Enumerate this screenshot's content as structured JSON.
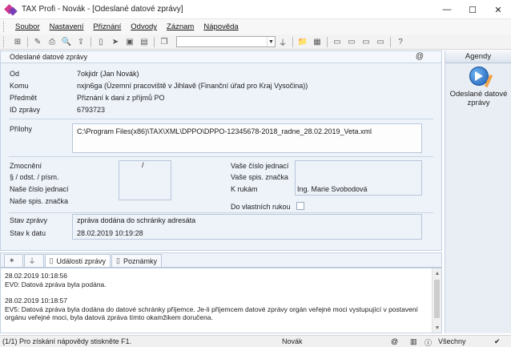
{
  "window": {
    "title": "TAX Profi - Novák - [Odeslané datové zprávy]",
    "controls": {
      "minimize": "—",
      "maximize": "☐",
      "close": "✕"
    }
  },
  "menu": [
    "Soubor",
    "Nastavení",
    "Přiznání",
    "Odvody",
    "Záznam",
    "Nápověda"
  ],
  "toolbar": {
    "combo_value": ""
  },
  "panel": {
    "title": "Odeslané datové zprávy",
    "at_symbol": "@"
  },
  "message": {
    "od_label": "Od",
    "od_value": "7okjidr (Jan Novák)",
    "komu_label": "Komu",
    "komu_value": "nxjn6ga (Územní pracoviště v Jihlavě (Finanční úřad pro Kraj Vysočina))",
    "predmet_label": "Předmět",
    "predmet_value": "Přiznání k dani z příjmů PO",
    "id_label": "ID zprávy",
    "id_value": "6793723",
    "prilohy_label": "Přílohy",
    "prilohy_value": "C:\\Program Files(x86)\\TAX\\XML\\DPPO\\DPPO-12345678-2018_radne_28.02.2019_Veta.xml",
    "zmocneni_label": "Zmocnění",
    "zmocneni_value": "/",
    "paragraf_label": "§ / odst. / písm.",
    "nase_cj_label": "Naše číslo jednací",
    "nase_sz_label": "Naše spis. značka",
    "vase_cj_label": "Vaše číslo jednací",
    "vase_sz_label": "Vaše spis. značka",
    "k_rukam_label": "K rukám",
    "k_rukam_value": "Ing. Marie Svobodová",
    "do_vlastnich_label": "Do vlastních rukou",
    "stav_label": "Stav zprávy",
    "stav_value": "zpráva dodána do schránky adresáta",
    "stav_datum_label": "Stav k datu",
    "stav_datum_value": "28.02.2019 10:19:28"
  },
  "agendy": {
    "header": "Agendy",
    "item_label_1": "Odeslané datové",
    "item_label_2": "zprávy"
  },
  "tabs": {
    "star": "✶",
    "filter": "⏚",
    "udalosti": "Události zprávy",
    "poznamky": "Poznámky"
  },
  "log": [
    {
      "time": "28.02.2019 10:18:56",
      "text": "EV0: Datová zpráva byla podána."
    },
    {
      "time": "28.02.2019 10:18:57",
      "text": "EV5: Datová zpráva byla dodána do datové schránky příjemce. Je-li příjemcem datové zprávy orgán veřejné moci vystupující v postavení orgánu veřejné moci, byla datová zpráva tímto okamžikem doručena."
    }
  ],
  "status": {
    "left": "(1/1)  Pro získání nápovědy stiskněte F1.",
    "user": "Novák",
    "filter": "Všechny"
  }
}
